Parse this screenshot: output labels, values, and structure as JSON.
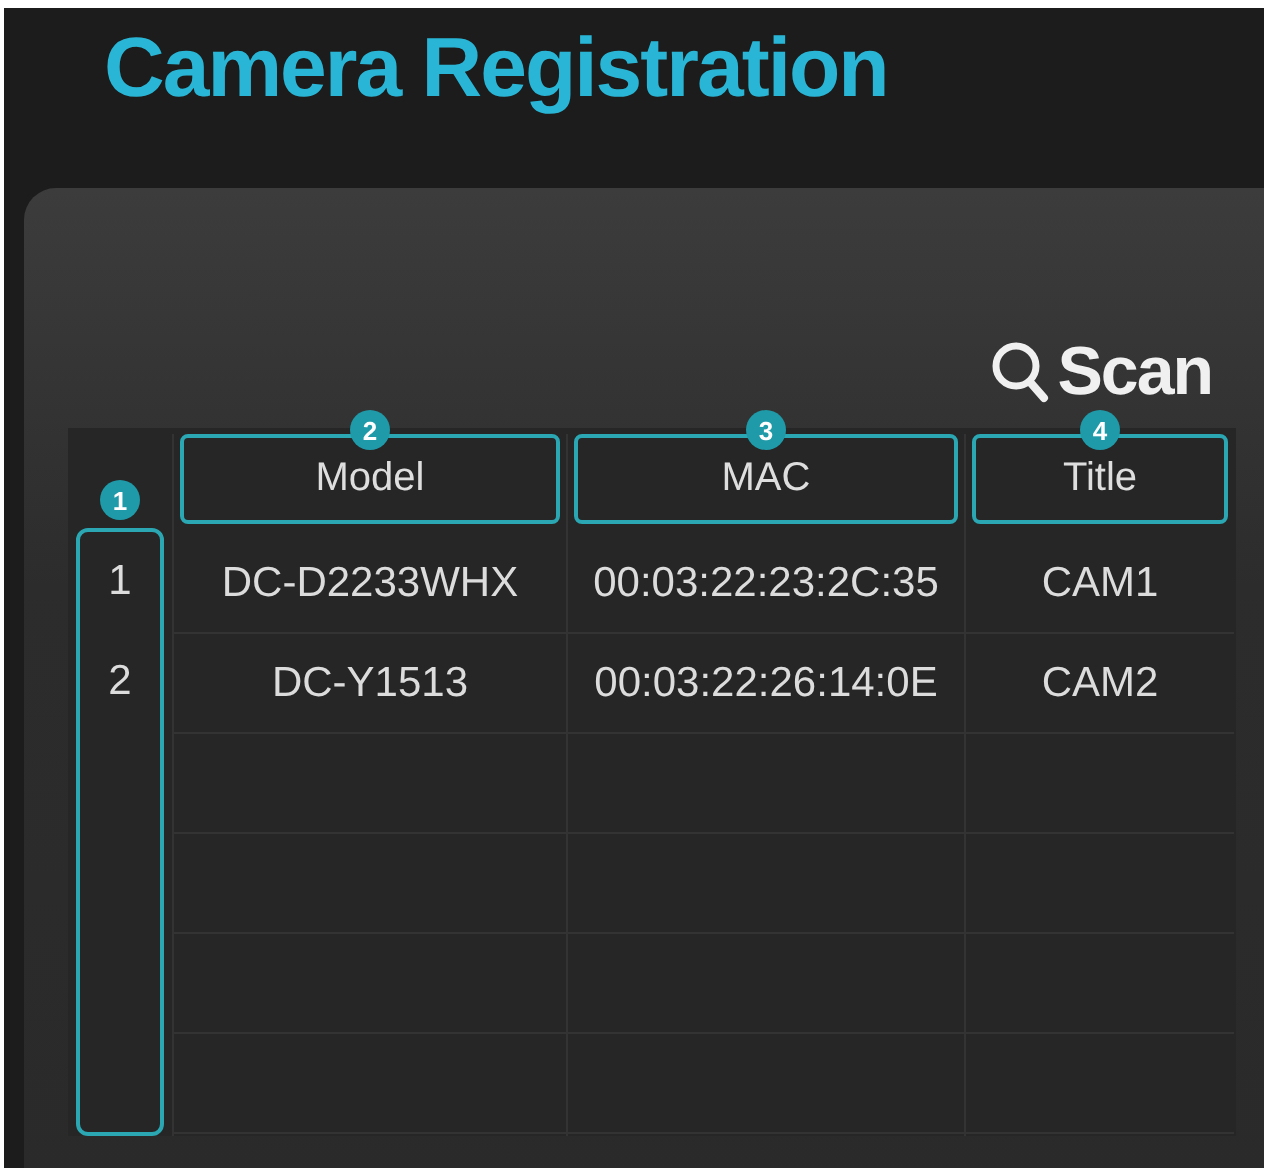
{
  "title": "Camera Registration",
  "scan_button": {
    "label": "Scan"
  },
  "index_badge": "1",
  "columns": [
    {
      "label": "Model",
      "badge": "2"
    },
    {
      "label": "MAC",
      "badge": "3"
    },
    {
      "label": "Title",
      "badge": "4"
    }
  ],
  "rows": [
    {
      "index": "1",
      "cells": [
        "DC-D2233WHX",
        "00:03:22:23:2C:35",
        "CAM1"
      ]
    },
    {
      "index": "2",
      "cells": [
        "DC-Y1513",
        "00:03:22:26:14:0E",
        "CAM2"
      ]
    }
  ]
}
